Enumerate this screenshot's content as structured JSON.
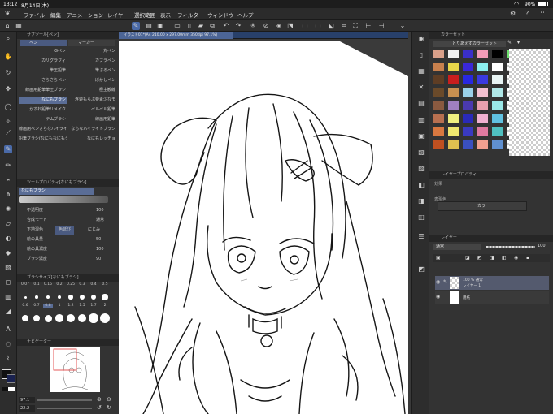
{
  "status": {
    "time": "13:12",
    "date": "8月14日(木)",
    "battery": "90%"
  },
  "menu": [
    "ファイル",
    "編集",
    "アニメーション",
    "レイヤー",
    "選択範囲",
    "表示",
    "フィルター",
    "ウィンドウ",
    "ヘルプ"
  ],
  "sub_tool_panel": {
    "title": "サブツール[ペン]",
    "tabs": [
      "ペン",
      "マーカー"
    ],
    "brushes_left": [
      "Gペン",
      "カリグラフィ",
      "筆圧鉛筆",
      "さらさらペン",
      "線画用鉛筆筆圧ブラシ",
      "なにもブラシ",
      "かすれ鉛筆リメイク",
      "テムブラシ",
      "線画用ペンさらなハイライトブラシ",
      "鉛筆ブラシ(なにもなにもクラ…"
    ],
    "brushes_right": [
      "丸ペン",
      "カブラペン",
      "筆ぶるペン",
      "ぼかしペン",
      "極主観線",
      "浮遊もらぶ要素少なモ",
      "ペルペル鉛筆",
      "線画用鉛筆",
      "ならなハイライトブラシ",
      "なにもレッチョ"
    ],
    "active_brush": "なにもブラシ"
  },
  "tool_property": {
    "title": "ツールプロパティ[なにもブラシ]",
    "brush_name": "なにもブラシ",
    "rows": [
      {
        "label": "不透明度",
        "value": "100"
      },
      {
        "label": "合成モード",
        "value": "通常"
      },
      {
        "label": "下地混色",
        "value": "色延び",
        "option": "にじみ"
      },
      {
        "label": "絵の具量",
        "value": "50"
      },
      {
        "label": "絵の具濃度",
        "value": "100"
      },
      {
        "label": "ブラシ濃度",
        "value": "90"
      }
    ]
  },
  "brush_size": {
    "title": "ブラシサイズ[なにもブラシ]",
    "values": [
      "0.07",
      "0.1",
      "0.15",
      "0.2",
      "0.25",
      "0.3",
      "0.4",
      "0.5",
      "0.6",
      "0.7",
      "0.8",
      "1",
      "1.2",
      "1.5",
      "1.7",
      "2"
    ]
  },
  "navigator": {
    "title": "ナビゲーター",
    "zoom": "97.1",
    "angle": "22.2"
  },
  "document": {
    "tab": "イラスト01*(A4 210.00 x 297.00mm 350dpi 97.1%)"
  },
  "color_set": {
    "title": "カラーセット",
    "set_name": "とりあえずカラーセット",
    "colors": [
      "#d9a08a",
      "#f2f2f2",
      "#3a2fc8",
      "#f29cb8",
      "#000000",
      "#6de06d",
      "#c8804d",
      "#e8d64a",
      "#3a28d8",
      "#8cf0f0",
      "#ffffff",
      "",
      "#5e3d24",
      "#c81e1e",
      "#2828e0",
      "#3a3ae0",
      "#e8f4f4",
      "",
      "#6a4a2a",
      "#c89050",
      "#9ad0e8",
      "#f2c0d0",
      "#b0e8e8",
      "",
      "#8a5a40",
      "#a080c0",
      "#4a3ab0",
      "#e8a0b0",
      "#9ae8e8",
      "",
      "#b87050",
      "#f0f080",
      "#2a2ab8",
      "#f0b0d0",
      "#60c0e0",
      "",
      "#d87840",
      "#f0e870",
      "#3a3ac0",
      "#e07aa0",
      "#50c0c0",
      "",
      "#c05020",
      "#e0c050",
      "#3a50c0",
      "#f0a090",
      "#6090d0",
      ""
    ]
  },
  "layer_property": {
    "title": "レイヤープロパティ",
    "effect": "効果",
    "expression_color": "表現色",
    "color_value": "カラー"
  },
  "layers": {
    "title": "レイヤー",
    "blend": "通常",
    "opacity": "100",
    "items": [
      {
        "mode": "100 % 通常",
        "name": "レイヤー 1"
      },
      {
        "mode": "",
        "name": "用紙"
      }
    ]
  }
}
